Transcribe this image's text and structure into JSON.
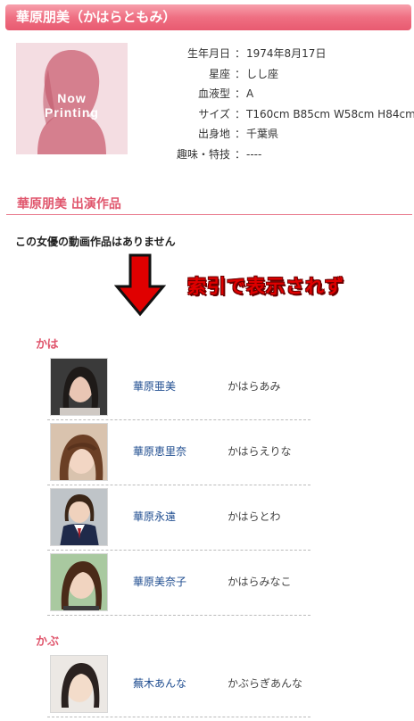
{
  "header": {
    "title": "華原朋美（かはらともみ）"
  },
  "profile_photo": {
    "line1": "Now",
    "line2": "Printing"
  },
  "profile": {
    "separator": "：",
    "rows": [
      {
        "label": "生年月日",
        "value": "1974年8月17日"
      },
      {
        "label": "星座",
        "value": "しし座"
      },
      {
        "label": "血液型",
        "value": "A"
      },
      {
        "label": "サイズ",
        "value": "T160cm B85cm W58cm H84cm"
      },
      {
        "label": "出身地",
        "value": "千葉県"
      },
      {
        "label": "趣味・特技",
        "value": "----"
      }
    ]
  },
  "works": {
    "heading": "華原朋美 出演作品",
    "empty_message": "この女優の動画作品はありません"
  },
  "annotation": {
    "text": "索引で表示されず",
    "color": "#e00000"
  },
  "index": {
    "groups": [
      {
        "label": "かは",
        "entries": [
          {
            "name": "華原亜美",
            "kana": "かはらあみ"
          },
          {
            "name": "華原恵里奈",
            "kana": "かはらえりな"
          },
          {
            "name": "華原永遠",
            "kana": "かはらとわ"
          },
          {
            "name": "華原美奈子",
            "kana": "かはらみなこ"
          }
        ]
      },
      {
        "label": "かぶ",
        "entries": [
          {
            "name": "蕪木あんな",
            "kana": "かぶらぎあんな"
          }
        ]
      }
    ]
  },
  "colors": {
    "accent": "#e0566d",
    "link": "#1d4b8f",
    "title_bar": "#ef6f82"
  }
}
